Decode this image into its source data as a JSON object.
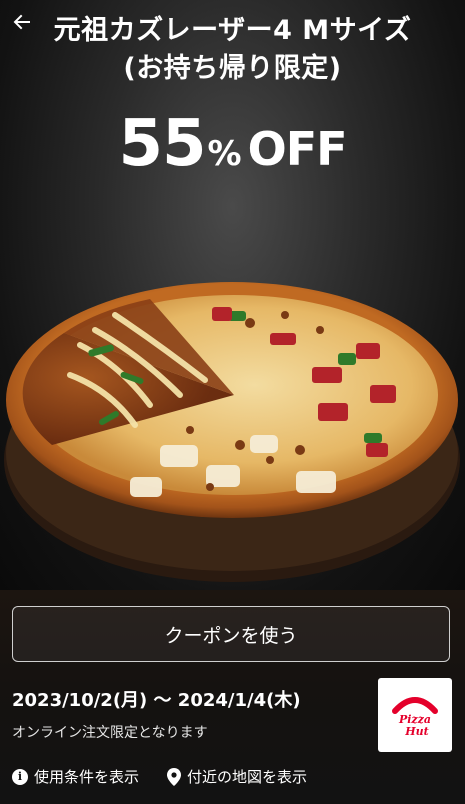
{
  "header": {
    "back_icon": "arrow-left-icon",
    "title_line1": "元祖カズレーザー4 Mサイズ",
    "title_line2": "(お持ち帰り限定)"
  },
  "discount": {
    "number": "55",
    "percent": "%",
    "off": "OFF"
  },
  "coupon": {
    "use_button_label": "クーポンを使う",
    "validity": "2023/10/2(月) 〜 2024/1/4(木)",
    "note": "オンライン注文限定となります",
    "brand_logo": "Pizza Hut",
    "brand_logo_lines": [
      "Pizza",
      "Hut"
    ]
  },
  "links": {
    "terms_label": "使用条件を表示",
    "terms_icon": "info-icon",
    "map_label": "付近の地図を表示",
    "map_icon": "location-pin-icon"
  },
  "colors": {
    "brand_red": "#e4002b",
    "background": "#121212"
  }
}
